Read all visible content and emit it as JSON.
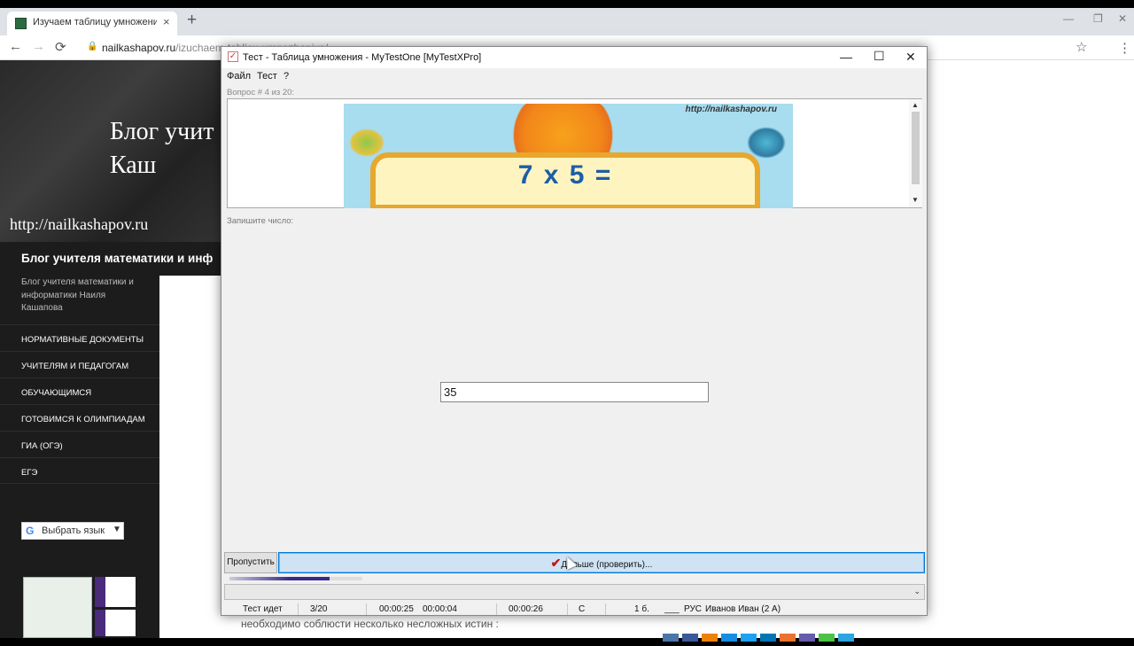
{
  "browser": {
    "tab_title": "Изучаем таблицу умножения. -",
    "tab_close": "×",
    "newtab": "+",
    "url_domain": "nailkashapov.ru",
    "url_path": "/izuchaem-tablicu-umnozheniya/",
    "back": "←",
    "forward": "→",
    "reload": "⟳",
    "lock": "🔒",
    "star": "☆",
    "menu": "⋮",
    "minimize": "—",
    "restore": "❐",
    "win_close": "✕"
  },
  "site": {
    "header_title": "Блог учит\nКаш",
    "header_url": "http://nailkashapov.ru",
    "blog_title": "Блог учителя математики и инф",
    "blog_desc": "Блог учителя математики и информатики Наиля Кашапова",
    "menu": [
      "НОРМАТИВНЫЕ ДОКУМЕНТЫ",
      "УЧИТЕЛЯМ И ПЕДАГОГАМ",
      "ОБУЧАЮЩИМСЯ",
      "ГОТОВИМСЯ К ОЛИМПИАДАМ",
      "ГИА (ОГЭ)",
      "ЕГЭ"
    ],
    "lang_icon": "G",
    "lang_label": "Выбрать язык",
    "lang_arrow": "▼",
    "bottom_text": "необходимо соблюсти несколько несложных истин :"
  },
  "test": {
    "window_title": "Тест - Таблица умножения - MyTestOne [MyTestXPro]",
    "minimize": "—",
    "maximize": "☐",
    "close": "✕",
    "menu": [
      "Файл",
      "Тест",
      "?"
    ],
    "question_number": "Вопрос # 4 из 20:",
    "image_url": "http://nailkashapov.ru",
    "expression": "7 x 5 =",
    "scroll_up": "▲",
    "scroll_down": "▼",
    "prompt": "Запишите число:",
    "answer": "35",
    "skip_button": "Пропустить",
    "next_icon": "✔",
    "next_button": "Дальше (проверить)...",
    "progress": 0.75,
    "combo_arrow": "⌄",
    "status": {
      "state": "Тест идет",
      "question": "3/20",
      "time1": "00:00:25",
      "time2": "00:00:04",
      "time3": "00:00:26",
      "grade": "С",
      "score": "1 б.",
      "blank": "___",
      "lang": "РУС",
      "user": "Иванов Иван (2 А)"
    }
  }
}
